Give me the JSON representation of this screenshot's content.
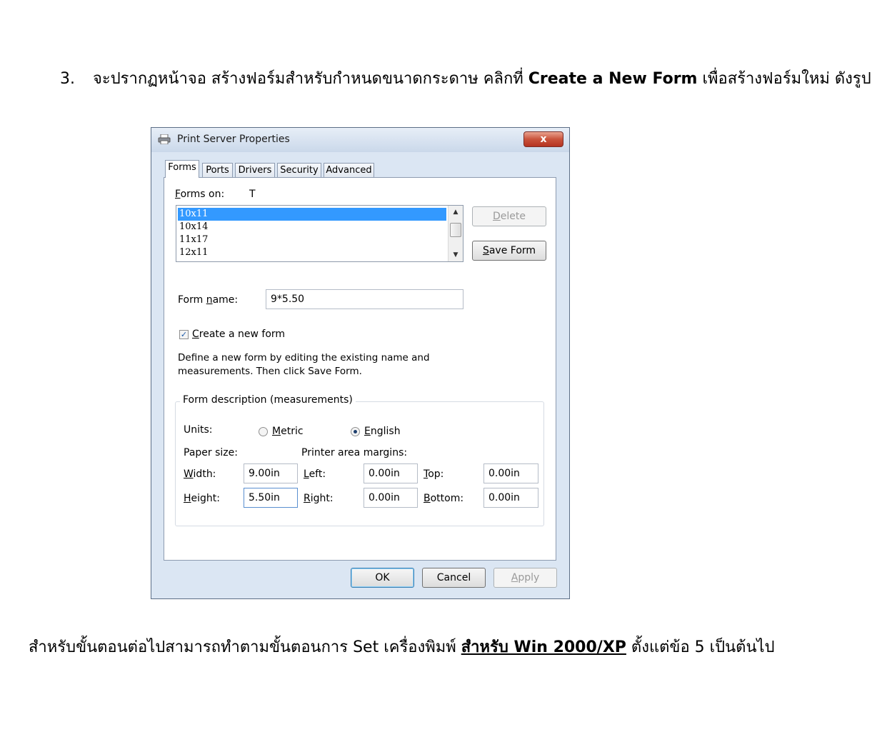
{
  "document": {
    "step_number": "3.",
    "step_text_before": "จะปรากฏหน้าจอ สร้างฟอร์มสำหรับกำหนดขนาดกระดาษ คลิกที่ ",
    "step_text_bold": "Create a New Form",
    "step_text_after": " เพื่อสร้างฟอร์มใหม่ ดังรูป",
    "footer_before": "สำหรับขั้นตอนต่อไปสามารถทำตามขั้นตอนการ Set เครื่องพิมพ์ ",
    "footer_link": "สำหรับ Win 2000/XP",
    "footer_after": " ตั้งแต่ข้อ 5 เป็นต้นไป"
  },
  "dialog": {
    "title": "Print Server Properties",
    "close_glyph": "x",
    "tabs": [
      {
        "label": "Forms",
        "active": true
      },
      {
        "label": "Ports",
        "active": false
      },
      {
        "label": "Drivers",
        "active": false
      },
      {
        "label": "Security",
        "active": false
      },
      {
        "label": "Advanced",
        "active": false
      }
    ],
    "forms_on": {
      "label_first": "F",
      "label_rest": "orms on:",
      "value": "T"
    },
    "forms_list": {
      "items": [
        "10x11",
        "10x14",
        "11x17",
        "12x11"
      ],
      "selected": "10x11"
    },
    "delete_button": {
      "first": "D",
      "rest": "elete",
      "enabled": false
    },
    "save_button": {
      "first": "S",
      "rest": "ave Form"
    },
    "form_name": {
      "label_before": "Form ",
      "label_key": "n",
      "label_after": "ame:",
      "value": "9*5.50"
    },
    "create_new_form": {
      "checked": true,
      "check_glyph": "✓",
      "key": "C",
      "rest": "reate a new form"
    },
    "description_lines": [
      "Define a new form by editing the existing name and",
      "measurements. Then click Save Form."
    ],
    "group_title": "Form description (measurements)",
    "units": {
      "label": "Units:",
      "metric": {
        "key": "M",
        "rest": "etric",
        "selected": false
      },
      "english": {
        "key": "E",
        "rest": "nglish",
        "selected": true
      }
    },
    "paper_size_label": "Paper size:",
    "margins_label": "Printer area margins:",
    "width": {
      "key": "W",
      "rest": "idth:",
      "value": "9.00in"
    },
    "height": {
      "key": "H",
      "rest": "eight:",
      "value": "5.50in"
    },
    "left": {
      "key": "L",
      "rest": "eft:",
      "value": "0.00in"
    },
    "right": {
      "key": "R",
      "rest": "ight:",
      "value": "0.00in"
    },
    "top": {
      "key": "T",
      "rest": "op:",
      "value": "0.00in"
    },
    "bottom": {
      "key": "B",
      "rest": "ottom:",
      "value": "0.00in"
    },
    "ok_label": "OK",
    "cancel_label": "Cancel",
    "apply": {
      "key": "A",
      "rest": "pply",
      "enabled": false
    }
  },
  "colors": {
    "selection": "#3399ff",
    "close_button": "#c9533c",
    "window_frame": "#dbe6f3"
  }
}
